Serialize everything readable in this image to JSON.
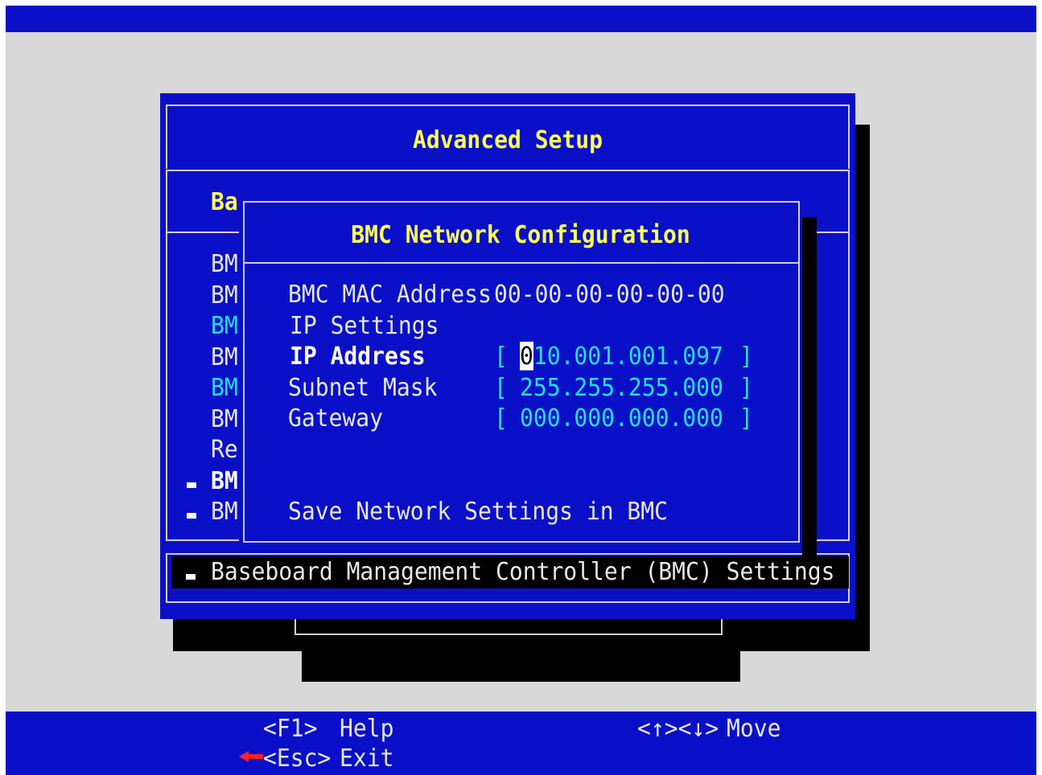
{
  "advanced_setup": {
    "title": "Advanced Setup",
    "menu_clipped": {
      "header": "Ba",
      "items": [
        "BM",
        "BM",
        "BM",
        "BM",
        "BM",
        "BM",
        "Re",
        "BM",
        "BM"
      ]
    },
    "selected_item": "Baseboard Management Controller (BMC) Settings"
  },
  "bmc_network": {
    "title": "BMC Network Configuration",
    "mac_label": "BMC MAC Address",
    "mac_value": "00-00-00-00-00-00",
    "ip_settings_label": "IP Settings",
    "fields": [
      {
        "label": "IP Address",
        "open": "[",
        "value_first": "0",
        "value_rest": "10.001.001.097",
        "close": "]"
      },
      {
        "label": "Subnet Mask",
        "open": "[",
        "value": "255.255.255.000",
        "close": "]"
      },
      {
        "label": "Gateway",
        "open": "[",
        "value": "000.000.000.000",
        "close": "]"
      }
    ],
    "save_label": "Save Network Settings in BMC"
  },
  "footer": {
    "help_key": "<F1>",
    "help_label": "Help",
    "move_key": "<↑><↓>",
    "move_label": "Move",
    "exit_key": "<Esc>",
    "exit_label": "Exit"
  },
  "colors": {
    "window_blue": "#0a10c8",
    "title_yellow": "#ffff55",
    "value_cyan": "#22e0ee",
    "background_gray": "#d8d8d8"
  }
}
